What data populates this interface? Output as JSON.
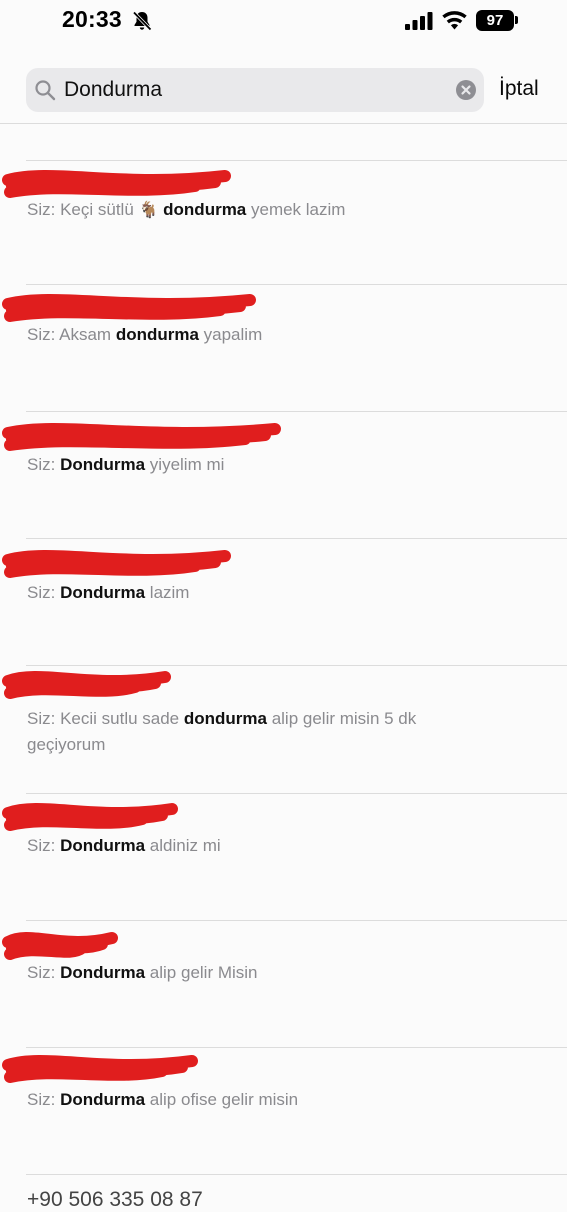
{
  "status_bar": {
    "time": "20:33",
    "battery": "97",
    "icons": [
      "bell-slash-icon",
      "cellular-signal-icon",
      "wifi-icon",
      "battery-icon"
    ]
  },
  "search": {
    "value": "Dondurma",
    "cancel_label": "İptal",
    "icons": [
      "magnifying-glass-icon",
      "clear-x-icon"
    ]
  },
  "redaction_color": "#e01e1e",
  "results": [
    {
      "prefix": "Siz:",
      "parts": [
        {
          "t": " Keçi sütlü ",
          "hl": false
        },
        {
          "t": "🐐",
          "hl": false,
          "emoji": true
        },
        {
          "t": " ",
          "hl": false
        },
        {
          "t": "dondurma",
          "hl": true
        },
        {
          "t": " yemek lazim",
          "hl": false
        }
      ]
    },
    {
      "prefix": "Siz:",
      "parts": [
        {
          "t": " Aksam ",
          "hl": false
        },
        {
          "t": "dondurma",
          "hl": true
        },
        {
          "t": " yapalim",
          "hl": false
        }
      ]
    },
    {
      "prefix": "Siz:",
      "parts": [
        {
          "t": " ",
          "hl": false
        },
        {
          "t": "Dondurma",
          "hl": true
        },
        {
          "t": " yiyelim mi",
          "hl": false
        }
      ]
    },
    {
      "prefix": "Siz:",
      "parts": [
        {
          "t": " ",
          "hl": false
        },
        {
          "t": "Dondurma",
          "hl": true
        },
        {
          "t": " lazim",
          "hl": false
        }
      ]
    },
    {
      "prefix": "Siz:",
      "parts": [
        {
          "t": " Kecii sutlu sade ",
          "hl": false
        },
        {
          "t": "dondurma",
          "hl": true
        },
        {
          "t": " alip gelir misin 5 dk geçiyorum",
          "hl": false
        }
      ]
    },
    {
      "prefix": "Siz:",
      "parts": [
        {
          "t": " ",
          "hl": false
        },
        {
          "t": "Dondurma",
          "hl": true
        },
        {
          "t": " aldiniz mi",
          "hl": false
        }
      ]
    },
    {
      "prefix": "Siz:",
      "parts": [
        {
          "t": " ",
          "hl": false
        },
        {
          "t": "Dondurma",
          "hl": true
        },
        {
          "t": " alip gelir Misin",
          "hl": false
        }
      ]
    },
    {
      "prefix": "Siz:",
      "parts": [
        {
          "t": " ",
          "hl": false
        },
        {
          "t": "Dondurma",
          "hl": true
        },
        {
          "t": " alip ofise gelir misin",
          "hl": false
        }
      ]
    }
  ],
  "partial_next_result": "+90 506 335 08 87"
}
